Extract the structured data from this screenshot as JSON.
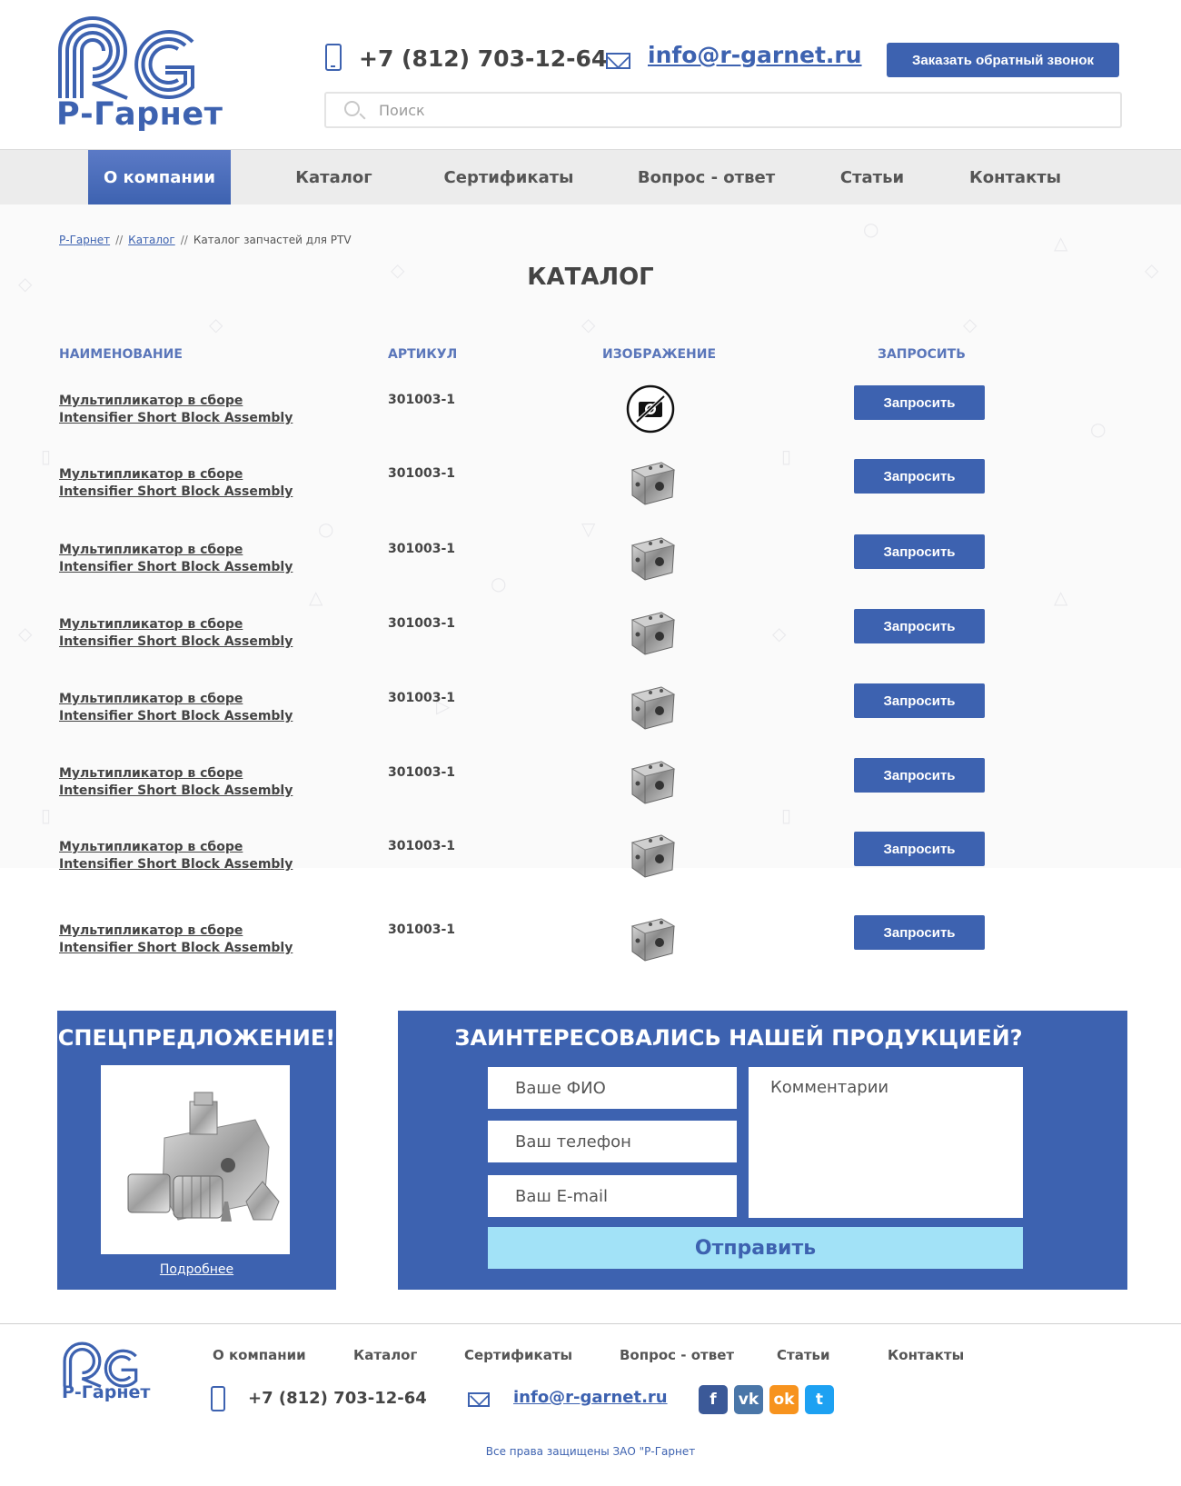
{
  "header": {
    "logo_text": "Р-Гарнет",
    "phone": "+7 (812) 703-12-64",
    "email": "info@r-garnet.ru",
    "callback_label": "Заказать обратный звонок",
    "search_placeholder": "Поиск"
  },
  "nav": {
    "items": [
      {
        "label": "О компании"
      },
      {
        "label": "Каталог"
      },
      {
        "label": "Сертификаты"
      },
      {
        "label": "Вопрос - ответ"
      },
      {
        "label": "Статьи"
      },
      {
        "label": "Контакты"
      }
    ],
    "active_index": 0
  },
  "breadcrumb": {
    "home": "Р-Гарнет",
    "separator": "//",
    "catalog": "Каталог",
    "current": "Каталог запчастей для PTV"
  },
  "page_title": "КАТАЛОГ",
  "table": {
    "headers": {
      "name": "НАИМЕНОВАНИЕ",
      "sku": "АРТИКУЛ",
      "image": "ИЗОБРАЖЕНИЕ",
      "request": "ЗАПРОСИТЬ"
    },
    "rows": [
      {
        "name_ru": "Мультипликатор в сборе",
        "name_en": "Intensifier Short Block Assembly",
        "sku": "301003-1",
        "image": "no-photo-icon",
        "button": "Запросить"
      },
      {
        "name_ru": "Мультипликатор в сборе",
        "name_en": "Intensifier Short Block Assembly",
        "sku": "301003-1",
        "image": "metal-block",
        "button": "Запросить"
      },
      {
        "name_ru": "Мультипликатор в сборе",
        "name_en": "Intensifier Short Block Assembly",
        "sku": "301003-1",
        "image": "metal-block",
        "button": "Запросить"
      },
      {
        "name_ru": "Мультипликатор в сборе",
        "name_en": "Intensifier Short Block Assembly",
        "sku": "301003-1",
        "image": "metal-block",
        "button": "Запросить"
      },
      {
        "name_ru": "Мультипликатор в сборе",
        "name_en": "Intensifier Short Block Assembly",
        "sku": "301003-1",
        "image": "metal-block",
        "button": "Запросить"
      },
      {
        "name_ru": "Мультипликатор в сборе",
        "name_en": "Intensifier Short Block Assembly",
        "sku": "301003-1",
        "image": "metal-block",
        "button": "Запросить"
      },
      {
        "name_ru": "Мультипликатор в сборе",
        "name_en": "Intensifier Short Block Assembly",
        "sku": "301003-1",
        "image": "metal-block",
        "button": "Запросить"
      },
      {
        "name_ru": "Мультипликатор в сборе",
        "name_en": "Intensifier Short Block Assembly",
        "sku": "301003-1",
        "image": "metal-block",
        "button": "Запросить"
      }
    ]
  },
  "promo": {
    "title": "СПЕЦПРЕДЛОЖЕНИЕ!",
    "more_link": "Подробнее"
  },
  "form": {
    "title": "ЗАИНТЕРЕСОВАЛИСЬ НАШЕЙ ПРОДУКЦИЕЙ?",
    "name_placeholder": "Ваше ФИО",
    "phone_placeholder": "Ваш телефон",
    "email_placeholder": "Ваш E-mail",
    "comment_placeholder": "Комментарии",
    "submit_label": "Отправить"
  },
  "footer": {
    "logo_text": "Р-Гарнет",
    "nav": [
      "О компании",
      "Каталог",
      "Сертификаты",
      "Вопрос - ответ",
      "Статьи",
      "Контакты"
    ],
    "phone": "+7 (812) 703-12-64",
    "email": "info@r-garnet.ru",
    "social": [
      {
        "icon": "facebook-icon",
        "glyph": "f",
        "color": "#3b5998"
      },
      {
        "icon": "vk-icon",
        "glyph": "vk",
        "color": "#4a76a8"
      },
      {
        "icon": "odnoklassniki-icon",
        "glyph": "ok",
        "color": "#f7931e"
      },
      {
        "icon": "twitter-icon",
        "glyph": "t",
        "color": "#1da1f2"
      }
    ],
    "copyright": "Все права защищены ЗАО \"Р-Гарнет"
  },
  "colors": {
    "brand": "#3d62b0",
    "submit_bg": "#a2e2f7",
    "nav_bg": "#ececec"
  }
}
